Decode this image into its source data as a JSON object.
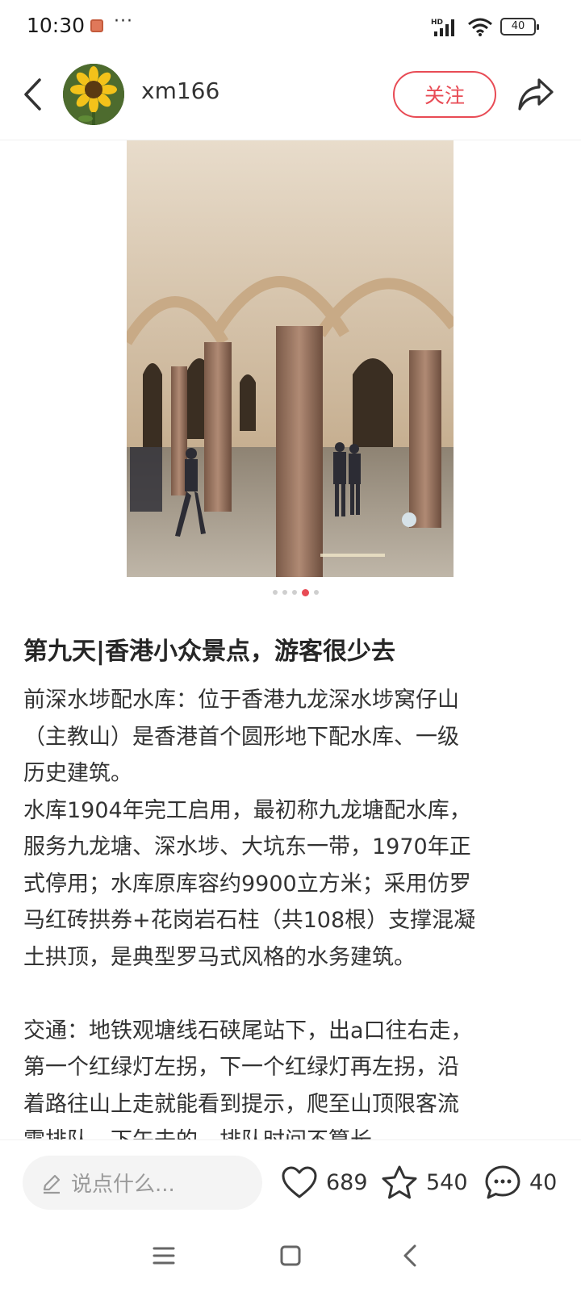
{
  "status_bar": {
    "time": "10:30",
    "more": "···",
    "hd_label": "HD",
    "battery": "40",
    "icons": [
      "app-notification-icon",
      "signal-icon",
      "wifi-icon",
      "battery-icon"
    ]
  },
  "header": {
    "username": "xm166",
    "follow_label": "关注",
    "icons": [
      "back-arrow-icon",
      "share-icon"
    ]
  },
  "gallery": {
    "image_count": 5,
    "current_index": 4
  },
  "post": {
    "title": "第九天|香港小众景点，游客很少去",
    "lines": [
      "前深水埗配水库：位于香港九龙深水埗窝仔山",
      "（主教山）是香港首个圆形地下配水库、一级",
      "历史建筑。",
      "水库1904年完工启用，最初称九龙塘配水库，",
      "服务九龙塘、深水埗、大坑东一带，1970年正",
      "式停用；水库原库容约9900立方米；采用仿罗",
      "马红砖拱券+花岗岩石柱（共108根）支撑混凝",
      "土拱顶，是典型罗马式风格的水务建筑。",
      "",
      "交通：地铁观塘线石硖尾站下，出a口往右走，",
      "第一个红绿灯左拐，下一个红绿灯再左拐，沿",
      "着路往山上走就能看到提示，爬至山顶限客流",
      "需排队，下午去的，排队时间不算长"
    ]
  },
  "actions": {
    "comment_placeholder": "说点什么...",
    "likes": "689",
    "favorites": "540",
    "comments": "40"
  },
  "colors": {
    "accent": "#e84b55",
    "text": "#333333",
    "input_bg": "#f4f4f4"
  }
}
